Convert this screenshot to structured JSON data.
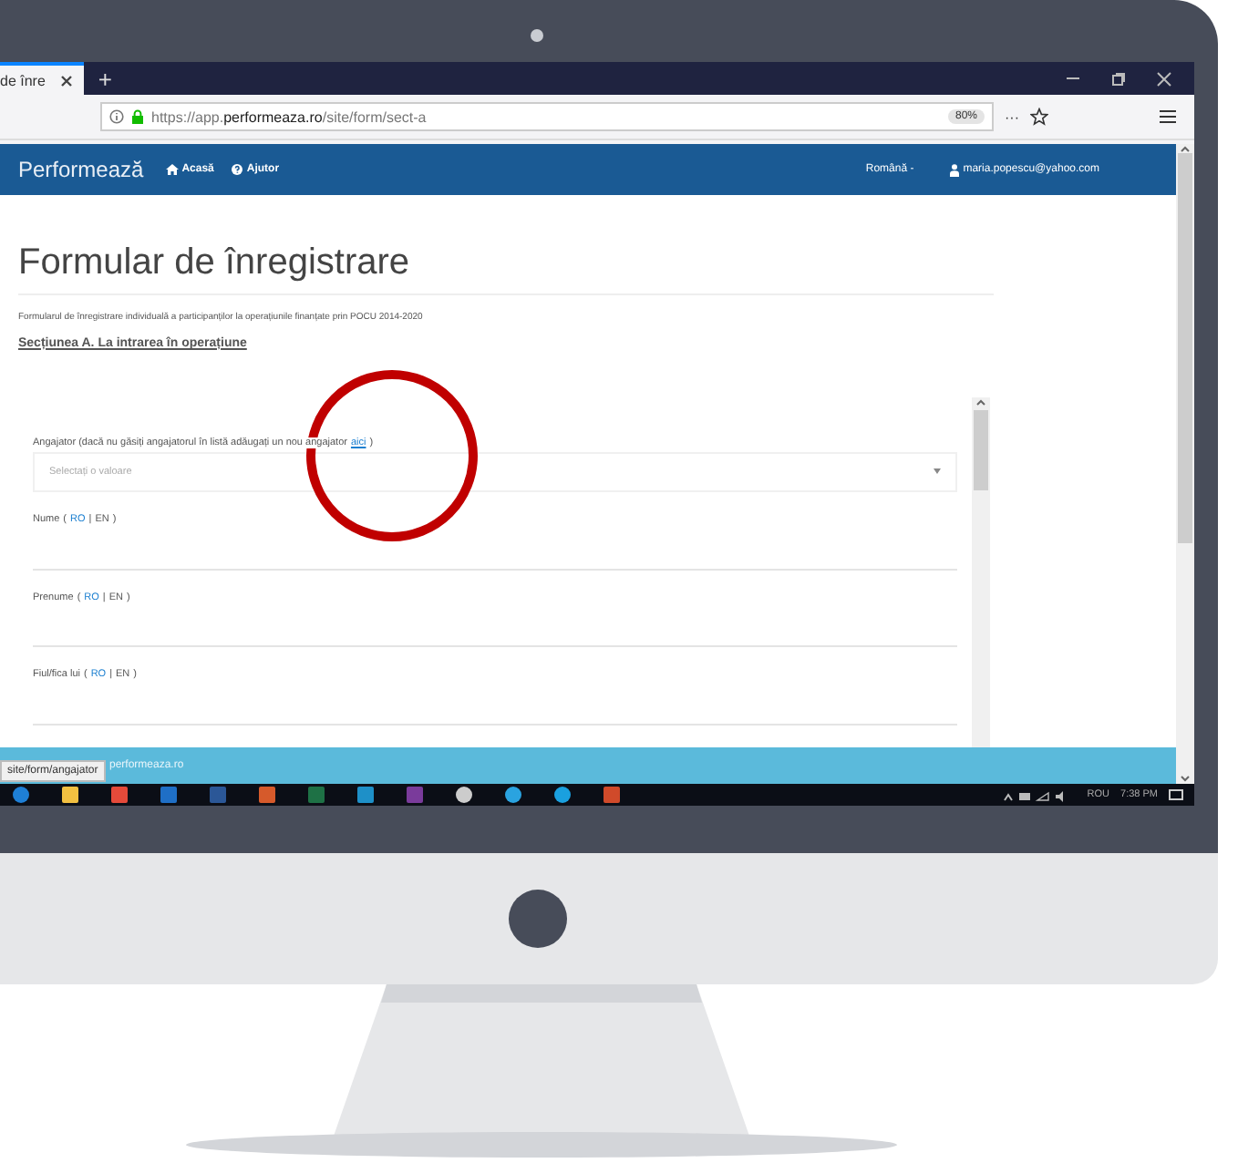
{
  "browser": {
    "tabs": [
      {
        "label": "de înre",
        "selected": true
      }
    ],
    "new_tab": "+",
    "url_host": "https://app.",
    "url_domain": "performeaza.ro",
    "url_path": "/site/form/sect-a",
    "zoom": "80%",
    "more": "···"
  },
  "navbar": {
    "brand": "Performează",
    "items": [
      {
        "kind": "home",
        "label": "Acasă"
      },
      {
        "kind": "help",
        "label": "Ajutor"
      }
    ],
    "language": "Română -",
    "user": "maria.popescu@yahoo.com"
  },
  "page": {
    "title": "Formular de înregistrare",
    "description": "Formularul de înregistrare individuală a participanților la operațiunile finanțate prin POCU 2014-2020",
    "section": "Secțiunea A. La intrarea în operațiune",
    "fields": [
      {
        "kind": "select",
        "label": "Angajator (dacă nu găsiți angajatorul în listă adăugați un nou angajator",
        "link": "aici",
        "label_end": ")",
        "placeholder": "Selectați o valoare"
      },
      {
        "kind": "text",
        "label": "Nume",
        "lang_open": "(",
        "lang_sep": "|",
        "lang_close": ")",
        "languages": [
          {
            "label": "RO",
            "selected": false
          },
          {
            "label": "EN",
            "selected": true
          }
        ]
      },
      {
        "kind": "text",
        "label": "Prenume",
        "lang_open": "(",
        "lang_sep": "|",
        "lang_close": ")",
        "languages": [
          {
            "label": "RO",
            "selected": false
          },
          {
            "label": "EN",
            "selected": true
          }
        ]
      },
      {
        "kind": "text",
        "label": "Fiul/fica lui",
        "lang_open": "(",
        "lang_sep": "|",
        "lang_close": ")",
        "languages": [
          {
            "label": "RO",
            "selected": false
          },
          {
            "label": "EN",
            "selected": true
          }
        ]
      }
    ],
    "footer": "performeaza.ro",
    "status_link": "site/form/angajator"
  },
  "taskbar": {
    "keyboard": "ROU",
    "clock": "7:38 PM"
  }
}
